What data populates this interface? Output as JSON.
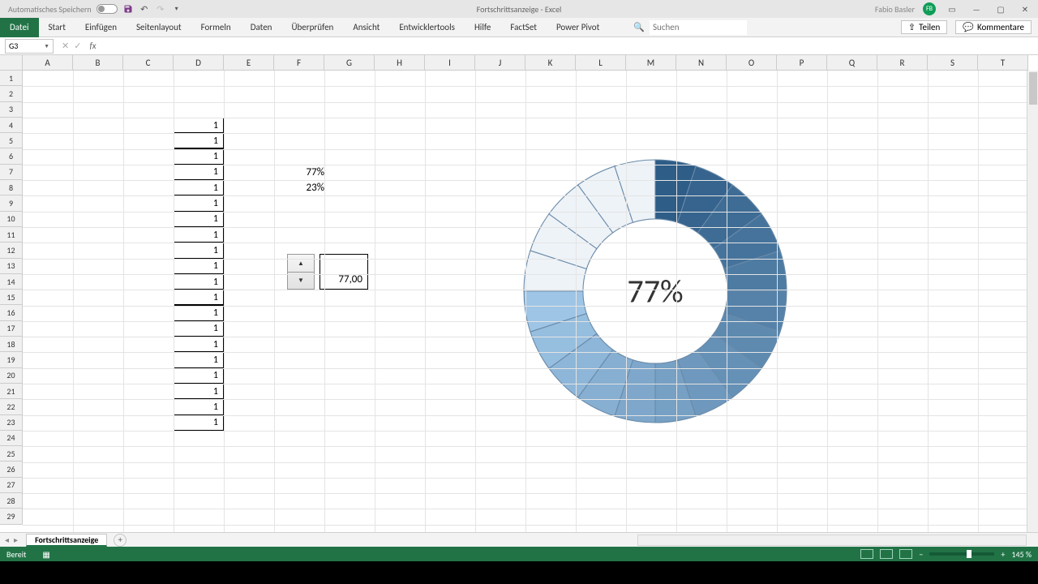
{
  "title_bar": {
    "autosave_label": "Automatisches Speichern",
    "doc_title": "Fortschrittsanzeige - Excel",
    "user_name": "Fabio Basler",
    "user_initials": "FB"
  },
  "ribbon": {
    "file": "Datei",
    "tabs": [
      "Start",
      "Einfügen",
      "Seitenlayout",
      "Formeln",
      "Daten",
      "Überprüfen",
      "Ansicht",
      "Entwicklertools",
      "Hilfe",
      "FactSet",
      "Power Pivot"
    ],
    "search_placeholder": "Suchen",
    "share": "Teilen",
    "comments": "Kommentare"
  },
  "formula_bar": {
    "name_box": "G3",
    "fx": "fx",
    "formula": ""
  },
  "columns": [
    "A",
    "B",
    "C",
    "D",
    "E",
    "F",
    "G",
    "H",
    "I",
    "J",
    "K",
    "L",
    "M",
    "N",
    "O",
    "P",
    "Q",
    "R",
    "S",
    "T"
  ],
  "rows": [
    "1",
    "2",
    "3",
    "4",
    "5",
    "6",
    "7",
    "8",
    "9",
    "10",
    "11",
    "12",
    "13",
    "14",
    "15",
    "16",
    "17",
    "18",
    "19",
    "20",
    "21",
    "22",
    "23",
    "24",
    "25",
    "26",
    "27",
    "28",
    "29"
  ],
  "data_d": [
    "1",
    "1",
    "1",
    "1",
    "1",
    "1",
    "1",
    "1",
    "1",
    "1",
    "1",
    "1",
    "1",
    "1",
    "1",
    "1",
    "1",
    "1",
    "1",
    "1"
  ],
  "pct1": "77%",
  "pct2": "23%",
  "spinner_value": "77,00",
  "chart_center": "77%",
  "sheet": {
    "name": "Fortschrittsanzeige",
    "ready": "Bereit",
    "zoom": "145 %"
  },
  "chart_data": {
    "type": "pie",
    "title": "",
    "segments": 20,
    "segment_values": [
      1,
      1,
      1,
      1,
      1,
      1,
      1,
      1,
      1,
      1,
      1,
      1,
      1,
      1,
      1,
      1,
      1,
      1,
      1,
      1
    ],
    "progress_percent": 77,
    "remaining_percent": 23,
    "center_label": "77%",
    "donut": true,
    "inner_radius_ratio": 0.55,
    "filled_color_range": [
      "#2e5d87",
      "#9ec5e6"
    ],
    "unfilled_color": "#eef3f8"
  }
}
